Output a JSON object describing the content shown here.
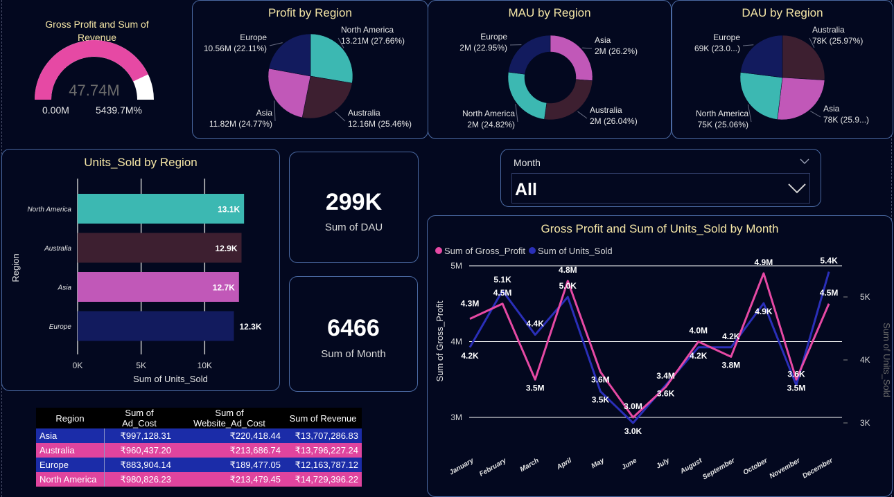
{
  "colors": {
    "background": "#03081f",
    "card_border": "#4b6aa3",
    "title": "#f5e6a6",
    "teal": "#3cb8b2",
    "maroon": "#3d1f30",
    "orchid": "#c158b8",
    "navy": "#121b5e",
    "pink": "#e649a4",
    "blue": "#2a2fb8"
  },
  "gauge": {
    "title": "Gross Profit and Sum of Revenue",
    "value": "47.74M",
    "min_label": "0.00M",
    "max_label": "5439.7M%",
    "fill_fraction": 0.86
  },
  "kpis": {
    "dau_value": "299K",
    "dau_label": "Sum of DAU",
    "month_value": "6466",
    "month_label": "Sum of Month"
  },
  "slicer": {
    "label": "Month",
    "value": "All"
  },
  "table": {
    "headers": [
      "Region",
      "Sum of Ad_Cost",
      "Sum of Website_Ad_Cost",
      "Sum of Revenue"
    ],
    "rows": [
      [
        "Asia",
        "₹997,128.31",
        "₹220,418.44",
        "₹13,707,286.83"
      ],
      [
        "Australia",
        "₹960,437.20",
        "₹213,686.74",
        "₹13,796,227.24"
      ],
      [
        "Europe",
        "₹883,904.14",
        "₹189,477.05",
        "₹12,163,787.12"
      ],
      [
        "North America",
        "₹980,826.23",
        "₹213,479.45",
        "₹14,729,396.22"
      ]
    ],
    "row_colors": [
      "#1b2ca8",
      "#e0449e",
      "#1b2ca8",
      "#e0449e"
    ]
  },
  "chart_data": [
    {
      "type": "pie",
      "title": "Profit by Region",
      "slices": [
        {
          "label": "North America",
          "value": 27.66,
          "text": "13.21M (27.66%)",
          "color": "#3cb8b2"
        },
        {
          "label": "Australia",
          "value": 25.46,
          "text": "12.16M (25.46%)",
          "color": "#3d1f30"
        },
        {
          "label": "Asia",
          "value": 24.77,
          "text": "11.82M (24.77%)",
          "color": "#c158b8"
        },
        {
          "label": "Europe",
          "value": 22.11,
          "text": "10.56M (22.11%)",
          "color": "#121b5e"
        }
      ]
    },
    {
      "type": "pie",
      "donut": true,
      "title": "MAU by Region",
      "slices": [
        {
          "label": "Asia",
          "value": 26.2,
          "text": "2M (26.2%)",
          "color": "#c158b8"
        },
        {
          "label": "Australia",
          "value": 26.04,
          "text": "2M (26.04%)",
          "color": "#3d1f30"
        },
        {
          "label": "North America",
          "value": 24.82,
          "text": "2M (24.82%)",
          "color": "#3cb8b2"
        },
        {
          "label": "Europe",
          "value": 22.95,
          "text": "2M (22.95%)",
          "color": "#121b5e"
        }
      ]
    },
    {
      "type": "pie",
      "title": "DAU by Region",
      "slices": [
        {
          "label": "Australia",
          "value": 25.97,
          "text": "78K (25.97%)",
          "color": "#3d1f30"
        },
        {
          "label": "Asia",
          "value": 25.9,
          "text": "78K (25.9...)",
          "color": "#c158b8"
        },
        {
          "label": "North America",
          "value": 25.06,
          "text": "75K (25.06%)",
          "color": "#3cb8b2"
        },
        {
          "label": "Europe",
          "value": 23.0,
          "text": "69K (23.0...)",
          "color": "#121b5e"
        }
      ]
    },
    {
      "type": "bar",
      "orientation": "horizontal",
      "title": "Units_Sold by Region",
      "xlabel": "Sum of Units_Sold",
      "ylabel": "Region",
      "categories": [
        "North America",
        "Australia",
        "Asia",
        "Europe"
      ],
      "values": [
        13100,
        12900,
        12700,
        12300
      ],
      "value_labels": [
        "13.1K",
        "12.9K",
        "12.7K",
        "12.3K"
      ],
      "colors": [
        "#3cb8b2",
        "#3d1f30",
        "#c158b8",
        "#121b5e"
      ],
      "xlim": [
        0,
        15000
      ],
      "xticks": [
        0,
        5000,
        10000
      ],
      "xtick_labels": [
        "0K",
        "5K",
        "10K"
      ]
    },
    {
      "type": "line",
      "title": "Gross Profit and Sum of Units_Sold by Month",
      "xlabel": "",
      "ylabel_left": "Sum of Gross_Profit",
      "ylabel_right": "Sum of Units_Sold",
      "categories": [
        "January",
        "February",
        "March",
        "April",
        "May",
        "June",
        "July",
        "August",
        "September",
        "October",
        "November",
        "December"
      ],
      "y_left_ticks": [
        "3M",
        "4M",
        "5M"
      ],
      "y_right_ticks": [
        "3K",
        "4K",
        "5K"
      ],
      "ylim_left": [
        3.0,
        5.0
      ],
      "ylim_right": [
        2.9,
        5.4
      ],
      "series": [
        {
          "name": "Sum of Gross_Profit",
          "axis": "left",
          "color": "#e649a4",
          "values": [
            4.3,
            4.5,
            3.5,
            4.8,
            3.6,
            3.0,
            3.4,
            4.0,
            3.8,
            4.9,
            3.5,
            4.5
          ],
          "labels": [
            "4.3M",
            "4.5M",
            "3.5M",
            "4.8M",
            "3.6M",
            "3.0M",
            "3.4M",
            "4.0M",
            "3.8M",
            "4.9M",
            "3.5M",
            "4.5M"
          ]
        },
        {
          "name": "Sum of Units_Sold",
          "axis": "right",
          "color": "#2a2fb8",
          "values": [
            4.2,
            5.1,
            4.4,
            5.0,
            3.5,
            3.0,
            3.6,
            4.2,
            4.2,
            4.9,
            3.6,
            5.4
          ],
          "labels": [
            "4.2K",
            "5.1K",
            "4.4K",
            "5.0K",
            "3.5K",
            "3.0K",
            "3.6K",
            "4.2K",
            "4.2K",
            "4.9K",
            "3.6K",
            "5.4K"
          ]
        }
      ]
    }
  ]
}
